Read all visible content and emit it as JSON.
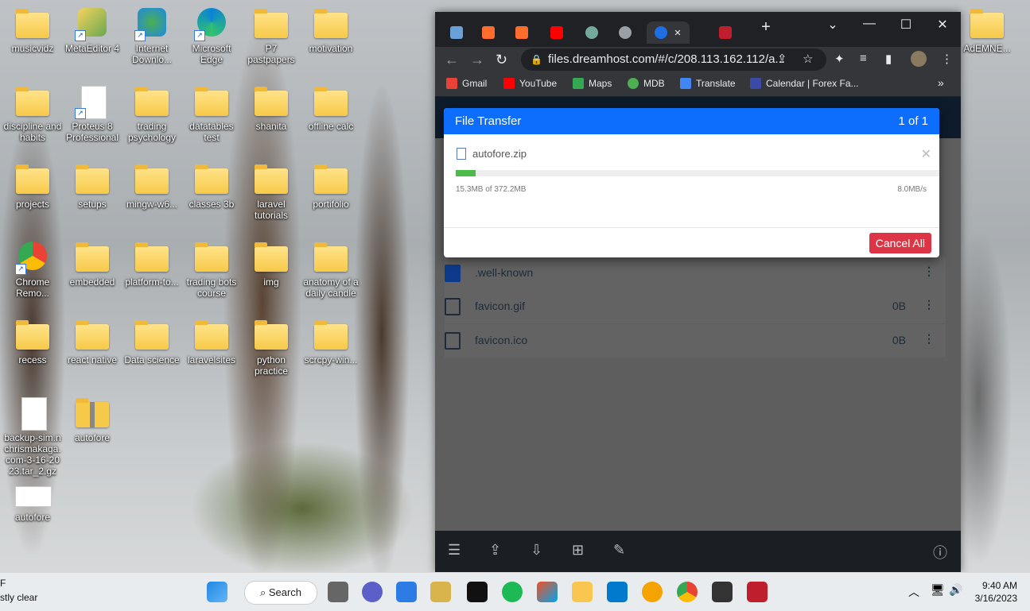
{
  "desktop": {
    "icons": [
      {
        "label": "musicvidz",
        "type": "folder"
      },
      {
        "label": "MetaEditor 4",
        "type": "app"
      },
      {
        "label": "Internet Downlo...",
        "type": "app"
      },
      {
        "label": "Microsoft Edge",
        "type": "app"
      },
      {
        "label": "P7 pastpapers",
        "type": "folder"
      },
      {
        "label": "motivation",
        "type": "folder"
      },
      {
        "label": "discipline and habits",
        "type": "folder"
      },
      {
        "label": "Proteus 8 Professional",
        "type": "file"
      },
      {
        "label": "trading psychology",
        "type": "folder"
      },
      {
        "label": "datatables test",
        "type": "folder"
      },
      {
        "label": "shanita",
        "type": "folder"
      },
      {
        "label": "offline calc",
        "type": "folder"
      },
      {
        "label": "projects",
        "type": "folder"
      },
      {
        "label": "setups",
        "type": "folder"
      },
      {
        "label": "mingw-w6...",
        "type": "folder"
      },
      {
        "label": "classes 3b",
        "type": "folder"
      },
      {
        "label": "laravel tutorials",
        "type": "folder"
      },
      {
        "label": "portifolio",
        "type": "folder"
      },
      {
        "label": "Chrome Remo...",
        "type": "app"
      },
      {
        "label": "embedded",
        "type": "folder"
      },
      {
        "label": "platform-to...",
        "type": "folder"
      },
      {
        "label": "trading bots course",
        "type": "folder"
      },
      {
        "label": "img",
        "type": "folder"
      },
      {
        "label": "anatomy of a daily candle",
        "type": "folder"
      },
      {
        "label": "recess",
        "type": "folder"
      },
      {
        "label": "react native",
        "type": "folder"
      },
      {
        "label": "Data science",
        "type": "folder"
      },
      {
        "label": "laravelsites",
        "type": "folder"
      },
      {
        "label": "python practice",
        "type": "folder"
      },
      {
        "label": "scrcpy-win...",
        "type": "folder"
      },
      {
        "label": "backup-sim.nchrismakaga.com-3-16-2023.tar_2.gz",
        "type": "file"
      },
      {
        "label": "autofore",
        "type": "zip"
      },
      {
        "label": "autofore",
        "type": "file"
      },
      {
        "label": "AdEMNE...",
        "type": "folder"
      }
    ]
  },
  "browser": {
    "url": "files.dreamhost.com/#/c/208.113.162.112/a...",
    "bookmarks": [
      "Gmail",
      "YouTube",
      "Maps",
      "MDB",
      "Translate",
      "Calendar | Forex Fa..."
    ],
    "files": [
      {
        "name": ".well-known",
        "size": ""
      },
      {
        "name": "favicon.gif",
        "size": "0B"
      },
      {
        "name": "favicon.ico",
        "size": "0B"
      }
    ]
  },
  "dialog": {
    "title": "File Transfer",
    "counter": "1 of 1",
    "filename": "autofore.zip",
    "progress_fraction": 0.041,
    "transferred": "15.3MB of 372.2MB",
    "speed": "8.0MB/s",
    "cancel_label": "Cancel All"
  },
  "taskbar": {
    "search_label": "Search",
    "time": "9:40 AM",
    "date": "3/16/2023",
    "weather_line1": "F",
    "weather_line2": "stly clear"
  }
}
